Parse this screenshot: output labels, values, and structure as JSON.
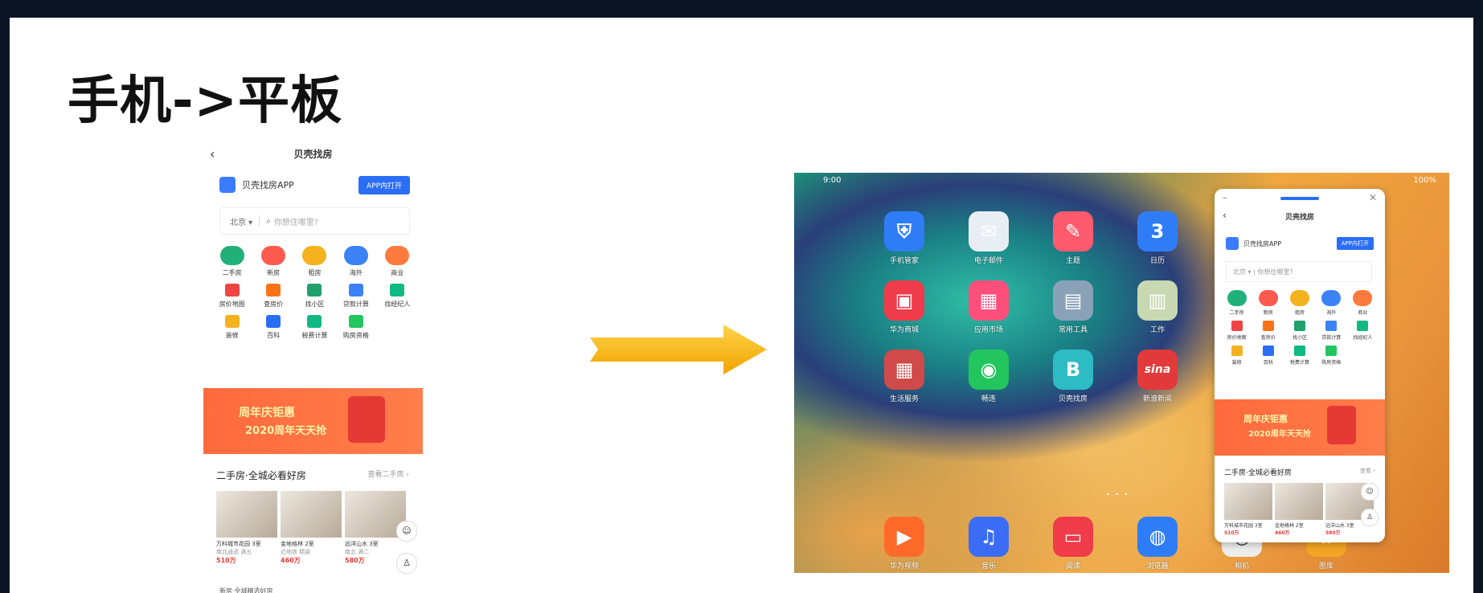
{
  "slide": {
    "title": "手机->平板"
  },
  "phone": {
    "status": "",
    "nav_title": "贝壳找房",
    "back_icon": "‹",
    "promo": {
      "app_name": "贝壳找房APP",
      "open_label": "APP内打开"
    },
    "search": {
      "city": "北京 ▾",
      "placeholder": "你想住哪里?"
    },
    "grid": [
      {
        "label": "二手房",
        "color": "#22b07a",
        "size": "lg"
      },
      {
        "label": "新房",
        "color": "#ff5a4e",
        "size": "lg"
      },
      {
        "label": "租房",
        "color": "#f5b21f",
        "size": "lg"
      },
      {
        "label": "海外",
        "color": "#3b82f6",
        "size": "lg"
      },
      {
        "label": "商业",
        "color": "#ff7a3d",
        "size": "lg"
      },
      {
        "label": "房价地图",
        "color": "#ef4444",
        "size": "sm"
      },
      {
        "label": "查房价",
        "color": "#f97316",
        "size": "sm"
      },
      {
        "label": "找小区",
        "color": "#22a06b",
        "size": "sm"
      },
      {
        "label": "贷款计算",
        "color": "#3b82f6",
        "size": "sm"
      },
      {
        "label": "找经纪人",
        "color": "#10b981",
        "size": "sm"
      },
      {
        "label": "装修",
        "color": "#f5b21f",
        "size": "sm"
      },
      {
        "label": "百科",
        "color": "#2b6ef6",
        "size": "sm"
      },
      {
        "label": "税费计算",
        "color": "#10b981",
        "size": "sm"
      },
      {
        "label": "购房资格",
        "color": "#22c55e",
        "size": "sm"
      }
    ],
    "banner": {
      "line1": "周年庆钜惠",
      "line2": "2020周年天天抢"
    },
    "section": {
      "title": "二手房·全城必看好房",
      "more": "查看二手房 ›"
    },
    "cards": [
      {
        "title": "万科城市花园 3室",
        "sub": "南北通透 满五",
        "price": "510万"
      },
      {
        "title": "金地格林 2室",
        "sub": "近地铁 精装",
        "price": "460万"
      },
      {
        "title": "远洋山水 3室",
        "sub": "南北 满二",
        "price": "580万"
      }
    ],
    "fab_chat": "☺",
    "fab_person": "♙",
    "bottom_text": "新房·全城精选好房"
  },
  "arrow_color": "#f5b400",
  "tablet": {
    "status_left": "9:00",
    "status_right": "100%",
    "apps": [
      {
        "label": "手机管家",
        "color": "#2f7df6",
        "glyph": "⛨"
      },
      {
        "label": "电子邮件",
        "color": "#e9eef5",
        "glyph": "✉"
      },
      {
        "label": "主题",
        "color": "#ff5a6e",
        "glyph": "✎"
      },
      {
        "label": "日历",
        "color": "#2f7df6",
        "glyph": "3"
      },
      {
        "label": "华为商城",
        "color": "#ef3b4a",
        "glyph": "▣"
      },
      {
        "label": "应用市场",
        "color": "#ff4f7a",
        "glyph": "▦"
      },
      {
        "label": "常用工具",
        "color": "#8aa2b8",
        "glyph": "▤"
      },
      {
        "label": "工作",
        "color": "#c8d8b0",
        "glyph": "▥"
      },
      {
        "label": "生活服务",
        "color": "#d04a4a",
        "glyph": "▦"
      },
      {
        "label": "畅连",
        "color": "#22c55e",
        "glyph": "◉"
      },
      {
        "label": "贝壳找房",
        "color": "#2dbbc4",
        "glyph": "B"
      },
      {
        "label": "新浪新闻",
        "color": "#e23a3a",
        "glyph": "sina"
      }
    ],
    "dock": [
      {
        "label": "华为视频",
        "color": "#ff6a2a",
        "glyph": "▶"
      },
      {
        "label": "音乐",
        "color": "#3b6cf6",
        "glyph": "♫"
      },
      {
        "label": "阅读",
        "color": "#ef3b4a",
        "glyph": "▭"
      },
      {
        "label": "浏览器",
        "color": "#2f7df6",
        "glyph": "◍"
      },
      {
        "label": "相机",
        "color": "#eeeeee",
        "glyph": "◎"
      },
      {
        "label": "图库",
        "color": "#f5a623",
        "glyph": "✿"
      }
    ],
    "page_dots": "• • •",
    "floating_window": {
      "nav_title": "贝壳找房",
      "app_name": "贝壳找房APP",
      "open_label": "APP内打开",
      "search_text": "北京 ▾ | 你想住哪里?",
      "banner_line1": "周年庆钜惠",
      "banner_line2": "2020周年天天抢",
      "section_title": "二手房·全城必看好房",
      "section_more": "查看 ›",
      "fab_chat": "☺",
      "fab_person": "♙"
    }
  }
}
